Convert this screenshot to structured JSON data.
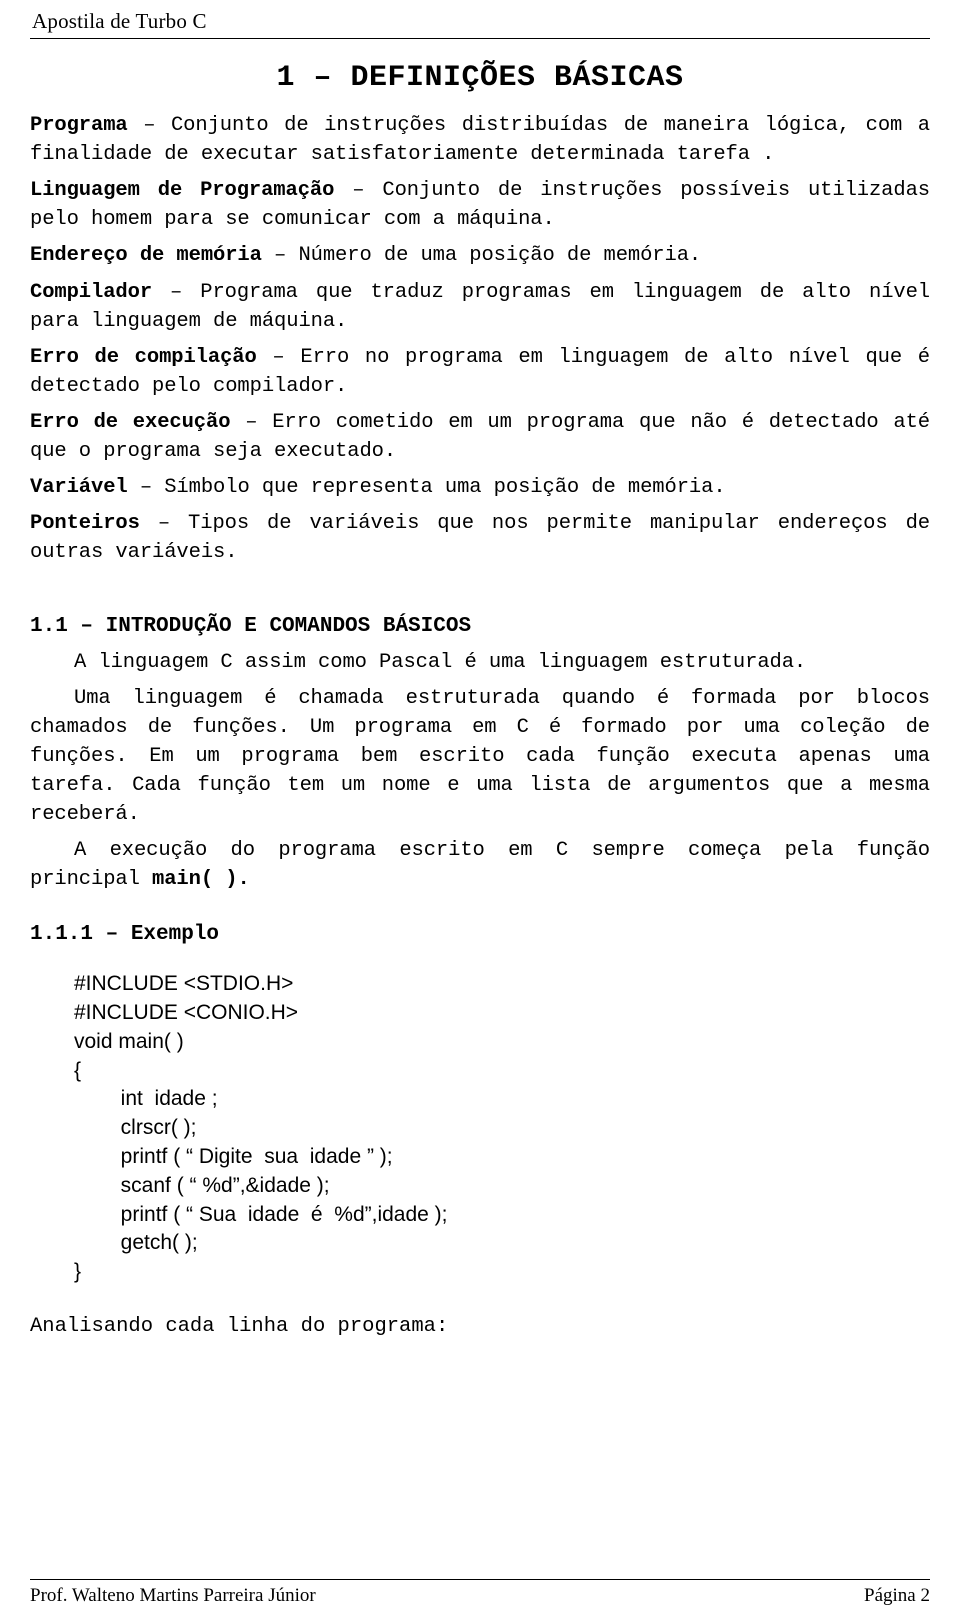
{
  "header": {
    "title": "Apostila de Turbo C"
  },
  "title": "1 – DEFINIÇÕES BÁSICAS",
  "definitions": [
    {
      "term": "Programa",
      "rest": " – Conjunto de instruções distribuídas de maneira lógica, com a finalidade de executar satisfatoriamente determinada tarefa ."
    },
    {
      "term": "Linguagem de Programação",
      "rest": " – Conjunto de instruções possíveis utilizadas pelo homem para se comunicar com a máquina."
    },
    {
      "term": "Endereço de memória",
      "rest": " – Número de uma posição de memória."
    },
    {
      "term": "Compilador",
      "rest": " – Programa que traduz programas em linguagem de alto nível para linguagem de máquina."
    },
    {
      "term": "Erro de compilação",
      "rest": " – Erro no programa em linguagem de alto nível que é detectado pelo compilador."
    },
    {
      "term": "Erro de execução",
      "rest": " – Erro cometido em um programa que não é detectado até que o programa seja executado."
    },
    {
      "term": "Variável",
      "rest": " – Símbolo que representa uma posição de memória."
    },
    {
      "term": "Ponteiros",
      "rest": " – Tipos de variáveis que nos permite manipular endereços de outras variáveis."
    }
  ],
  "section_1_1": {
    "heading": "1.1 – INTRODUÇÃO E COMANDOS BÁSICOS",
    "p1": "A linguagem C assim como Pascal é uma linguagem estruturada.",
    "p2": "Uma linguagem é chamada estruturada quando é formada por blocos chamados de funções. Um programa em C é formado por uma coleção de funções. Em um programa bem escrito cada função executa apenas uma tarefa. Cada função tem um nome e uma lista de argumentos que a mesma receberá.",
    "p3_before": "A execução do programa escrito em C sempre começa pela função principal ",
    "p3_bold": "main( ).",
    "p3_after": ""
  },
  "section_1_1_1": {
    "heading": "1.1.1 – Exemplo",
    "code": "#INCLUDE <STDIO.H>\n#INCLUDE <CONIO.H>\nvoid main( )\n{\n        int  idade ;\n        clrscr( );\n        printf ( “ Digite  sua  idade ” );\n        scanf ( “ %d”,&idade );\n        printf ( “ Sua  idade  é  %d”,idade );\n        getch( );\n}",
    "after": "Analisando cada linha do programa:"
  },
  "footer": {
    "author": "Prof. Walteno Martins Parreira Júnior",
    "page": "Página 2"
  }
}
